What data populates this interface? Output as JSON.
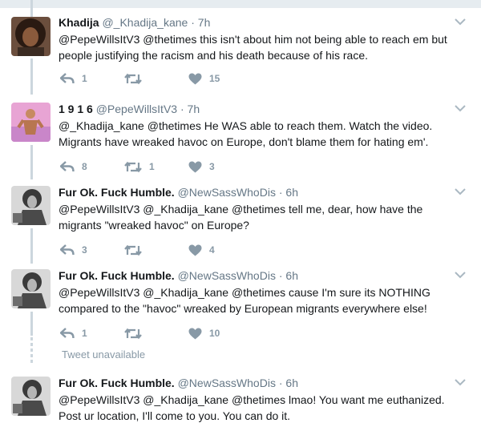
{
  "tweets": [
    {
      "name": "Khadija",
      "handle": "@_Khadija_kane",
      "separator": "·",
      "time": "7h",
      "text": "@PepeWillsItV3 @thetimes this isn't about him not being able to reach em but people justifying the racism and his death because of his race.",
      "replies": "1",
      "retweets": "",
      "likes": "15"
    },
    {
      "name": "1 9 1 6",
      "handle": "@PepeWillsItV3",
      "separator": "·",
      "time": "7h",
      "text": "@_Khadija_kane @thetimes He WAS able to reach them. Watch the video. Migrants have wreaked havoc on Europe, don't blame them for hating em'.",
      "replies": "8",
      "retweets": "1",
      "likes": "3"
    },
    {
      "name": "Fur Ok. Fuck Humble.",
      "handle": "@NewSassWhoDis",
      "separator": "·",
      "time": "6h",
      "text": "@PepeWillsItV3 @_Khadija_kane @thetimes tell me, dear, how have the migrants \"wreaked havoc\" on Europe?",
      "replies": "3",
      "retweets": "",
      "likes": "4"
    },
    {
      "name": "Fur Ok. Fuck Humble.",
      "handle": "@NewSassWhoDis",
      "separator": "·",
      "time": "6h",
      "text": "@PepeWillsItV3 @_Khadija_kane @thetimes cause I'm sure its NOTHING compared to the \"havoc\" wreaked by European migrants everywhere else!",
      "replies": "1",
      "retweets": "",
      "likes": "10"
    },
    {
      "name": "Fur Ok. Fuck Humble.",
      "handle": "@NewSassWhoDis",
      "separator": "·",
      "time": "6h",
      "text": "@PepeWillsItV3 @_Khadija_kane @thetimes lmao! You want me euthanized. Post ur location, I'll come to you. You can do it.",
      "replies": "",
      "retweets": "",
      "likes": ""
    }
  ],
  "unavailable_label": "Tweet unavailable",
  "icons": {
    "reply": "reply-icon",
    "retweet": "retweet-icon",
    "like": "heart-icon",
    "more": "chevron-down-icon"
  },
  "colors": {
    "text": "#14171a",
    "muted": "#657786",
    "action": "#8899a6",
    "rail": "#ccd6dd",
    "divider": "#e6ecf0"
  }
}
